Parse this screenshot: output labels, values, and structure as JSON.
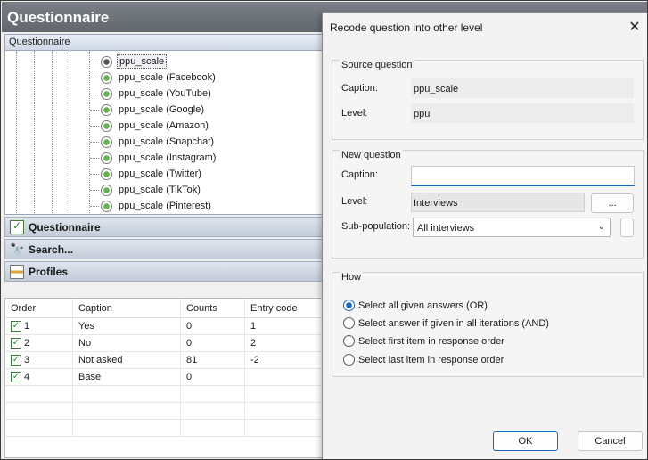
{
  "window": {
    "title": "Questionnaire"
  },
  "tree": {
    "header": "Questionnaire",
    "items": [
      {
        "label": "ppu_scale",
        "selected": true
      },
      {
        "label": "ppu_scale (Facebook)"
      },
      {
        "label": "ppu_scale (YouTube)"
      },
      {
        "label": "ppu_scale (Google)"
      },
      {
        "label": "ppu_scale (Amazon)"
      },
      {
        "label": "ppu_scale (Snapchat)"
      },
      {
        "label": "ppu_scale (Instagram)"
      },
      {
        "label": "ppu_scale (Twitter)"
      },
      {
        "label": "ppu_scale (TikTok)"
      },
      {
        "label": "ppu_scale (Pinterest)"
      }
    ]
  },
  "panels": {
    "questionnaire": "Questionnaire",
    "search": "Search...",
    "profiles": "Profiles"
  },
  "codes": {
    "headers": {
      "order": "Order",
      "caption": "Caption",
      "counts": "Counts",
      "entry": "Entry code"
    },
    "rows": [
      {
        "order": "1",
        "caption": "Yes",
        "counts": "0",
        "entry": "1"
      },
      {
        "order": "2",
        "caption": "No",
        "counts": "0",
        "entry": "2"
      },
      {
        "order": "3",
        "caption": "Not asked",
        "counts": "81",
        "entry": "-2"
      },
      {
        "order": "4",
        "caption": "Base",
        "counts": "0",
        "entry": ""
      }
    ]
  },
  "dialog": {
    "title": "Recode question into other level",
    "source": {
      "group_title": "Source question",
      "caption_label": "Caption:",
      "caption_value": "ppu_scale",
      "level_label": "Level:",
      "level_value": "ppu"
    },
    "new_question": {
      "group_title": "New question",
      "caption_label": "Caption:",
      "caption_value": "",
      "level_label": "Level:",
      "level_value": "Interviews",
      "browse_label": "...",
      "subpop_label": "Sub-population:",
      "subpop_value": "All interviews"
    },
    "how": {
      "group_title": "How",
      "options": [
        {
          "label": "Select all given answers (OR)",
          "checked": true
        },
        {
          "label": "Select answer if given in all iterations (AND)",
          "checked": false
        },
        {
          "label": "Select first item in response order",
          "checked": false
        },
        {
          "label": "Select last item in response order",
          "checked": false
        }
      ]
    },
    "ok_label": "OK",
    "cancel_label": "Cancel",
    "close_glyph": "✕"
  }
}
